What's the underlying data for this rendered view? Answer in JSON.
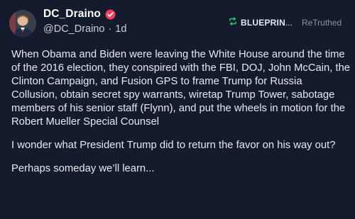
{
  "author": {
    "display_name": "DC_Draino",
    "handle": "@DC_Draino",
    "separator": "·",
    "time_ago": "1d",
    "verified_color": "#f23c5e"
  },
  "retruth": {
    "user": "BLUEPRIN",
    "ellipsis": "...",
    "label": "ReTruthed",
    "icon_color": "#2fbf71"
  },
  "post": {
    "paragraphs": [
      "When Obama and Biden were leaving the White House around the time of the 2016 election, they conspired with the FBI, DOJ, John McCain, the Clinton Campaign, and Fusion GPS to frame Trump for Russia Collusion, obtain secret spy warrants, wiretap Trump Tower, sabotage members of his senior staff (Flynn), and put the wheels in motion for the Robert Mueller Special Counsel",
      "I wonder what President Trump did to return the favor on his way out?",
      "Perhaps someday we’ll learn..."
    ]
  }
}
